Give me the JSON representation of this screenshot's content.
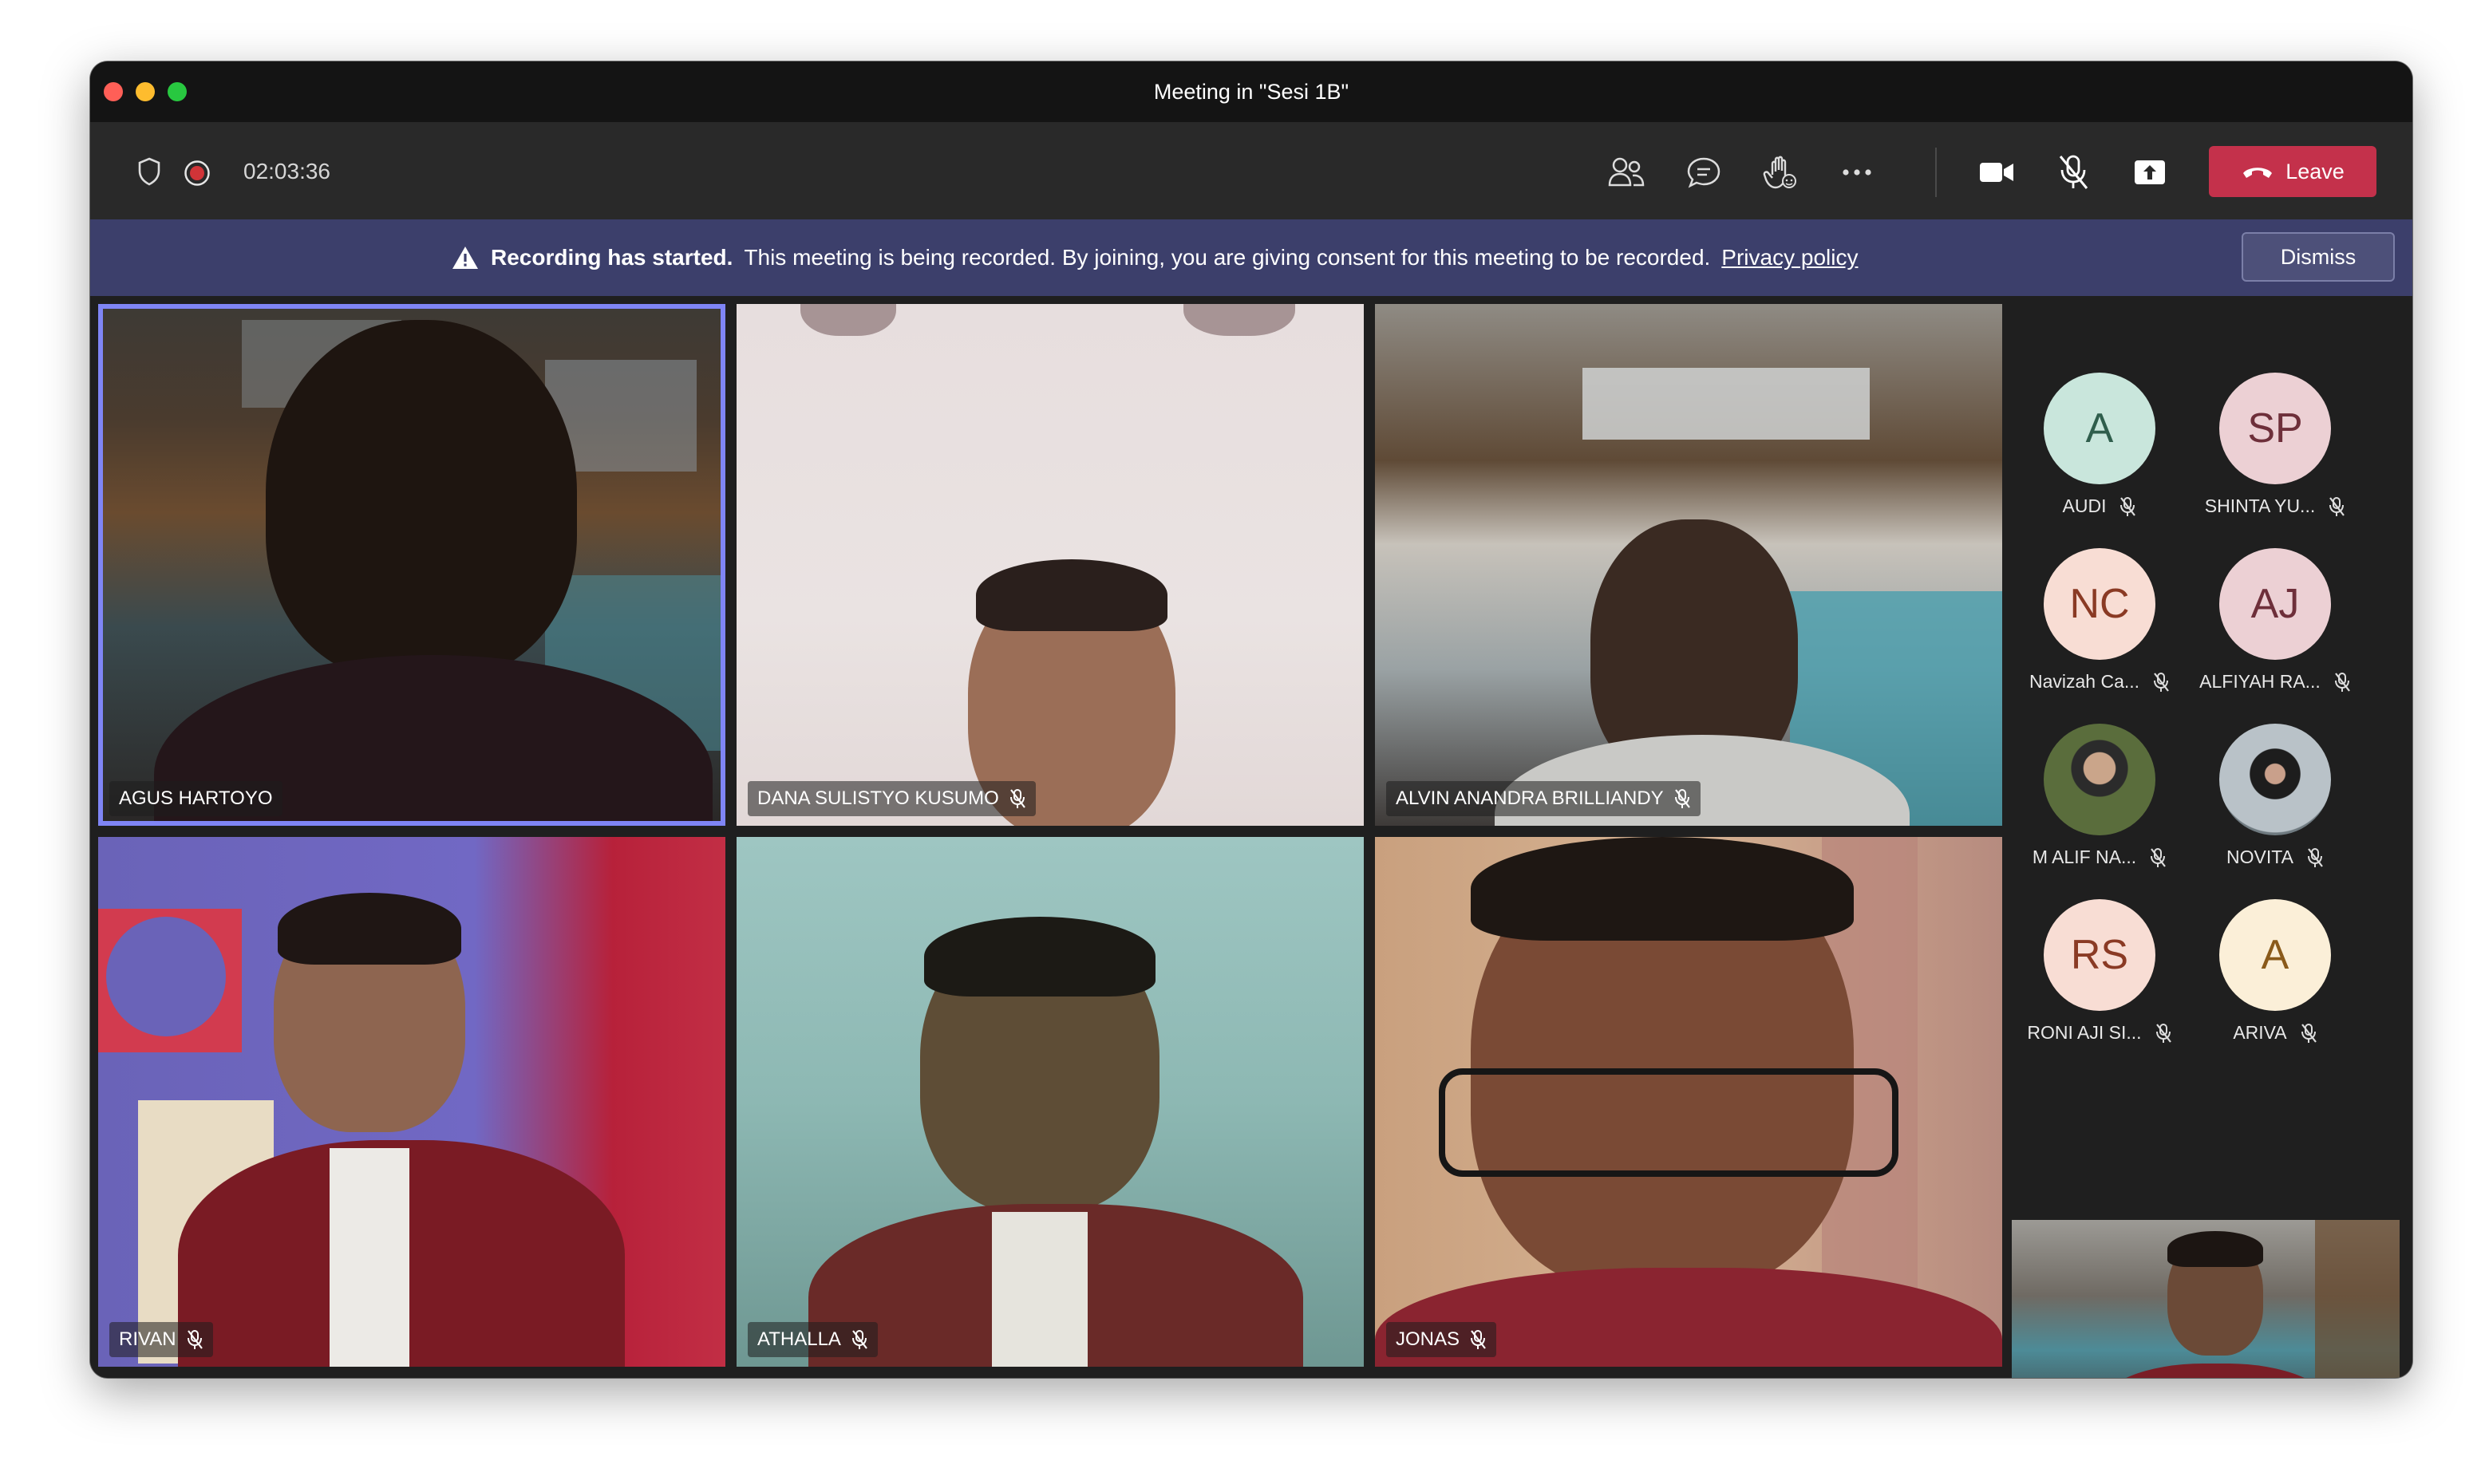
{
  "window": {
    "title": "Meeting in \"Sesi 1B\""
  },
  "toolbar": {
    "timer": "02:03:36",
    "leave_label": "Leave",
    "icons": [
      "shield-icon",
      "record-icon",
      "people-icon",
      "chat-icon",
      "raise-hand-icon",
      "more-icon",
      "camera-icon",
      "mic-off-icon",
      "share-screen-icon",
      "phone-icon"
    ]
  },
  "banner": {
    "title": "Recording has started.",
    "message": "This meeting is being recorded. By joining, you are giving consent for this meeting to be recorded.",
    "link": "Privacy policy",
    "dismiss_label": "Dismiss"
  },
  "tiles": [
    {
      "name": "AGUS HARTOYO",
      "muted": false,
      "active": true
    },
    {
      "name": "DANA SULISTYO KUSUMO",
      "muted": true
    },
    {
      "name": "ALVIN ANANDRA BRILLIANDY",
      "muted": true
    },
    {
      "name": "RIVAN",
      "muted": true
    },
    {
      "name": "ATHALLA",
      "muted": true
    },
    {
      "name": "JONAS",
      "muted": true
    }
  ],
  "participants": [
    {
      "initials": "A",
      "name": "AUDI",
      "color": "#c9e6dc"
    },
    {
      "initials": "SP",
      "name": "SHINTA YU...",
      "color": "#ecd0d4"
    },
    {
      "initials": "NC",
      "name": "Navizah Ca...",
      "color": "#f8ddd4"
    },
    {
      "initials": "AJ",
      "name": "ALFIYAH RA...",
      "color": "#ecd0d4"
    },
    {
      "initials": "",
      "name": "M ALIF NA...",
      "color": "#7d8a5a"
    },
    {
      "initials": "",
      "name": "NOVITA",
      "color": "#a4aeb6"
    },
    {
      "initials": "RS",
      "name": "RONI AJI SI...",
      "color": "#f8ddd4"
    },
    {
      "initials": "A",
      "name": "ARIVA",
      "color": "#fbefd8"
    }
  ]
}
